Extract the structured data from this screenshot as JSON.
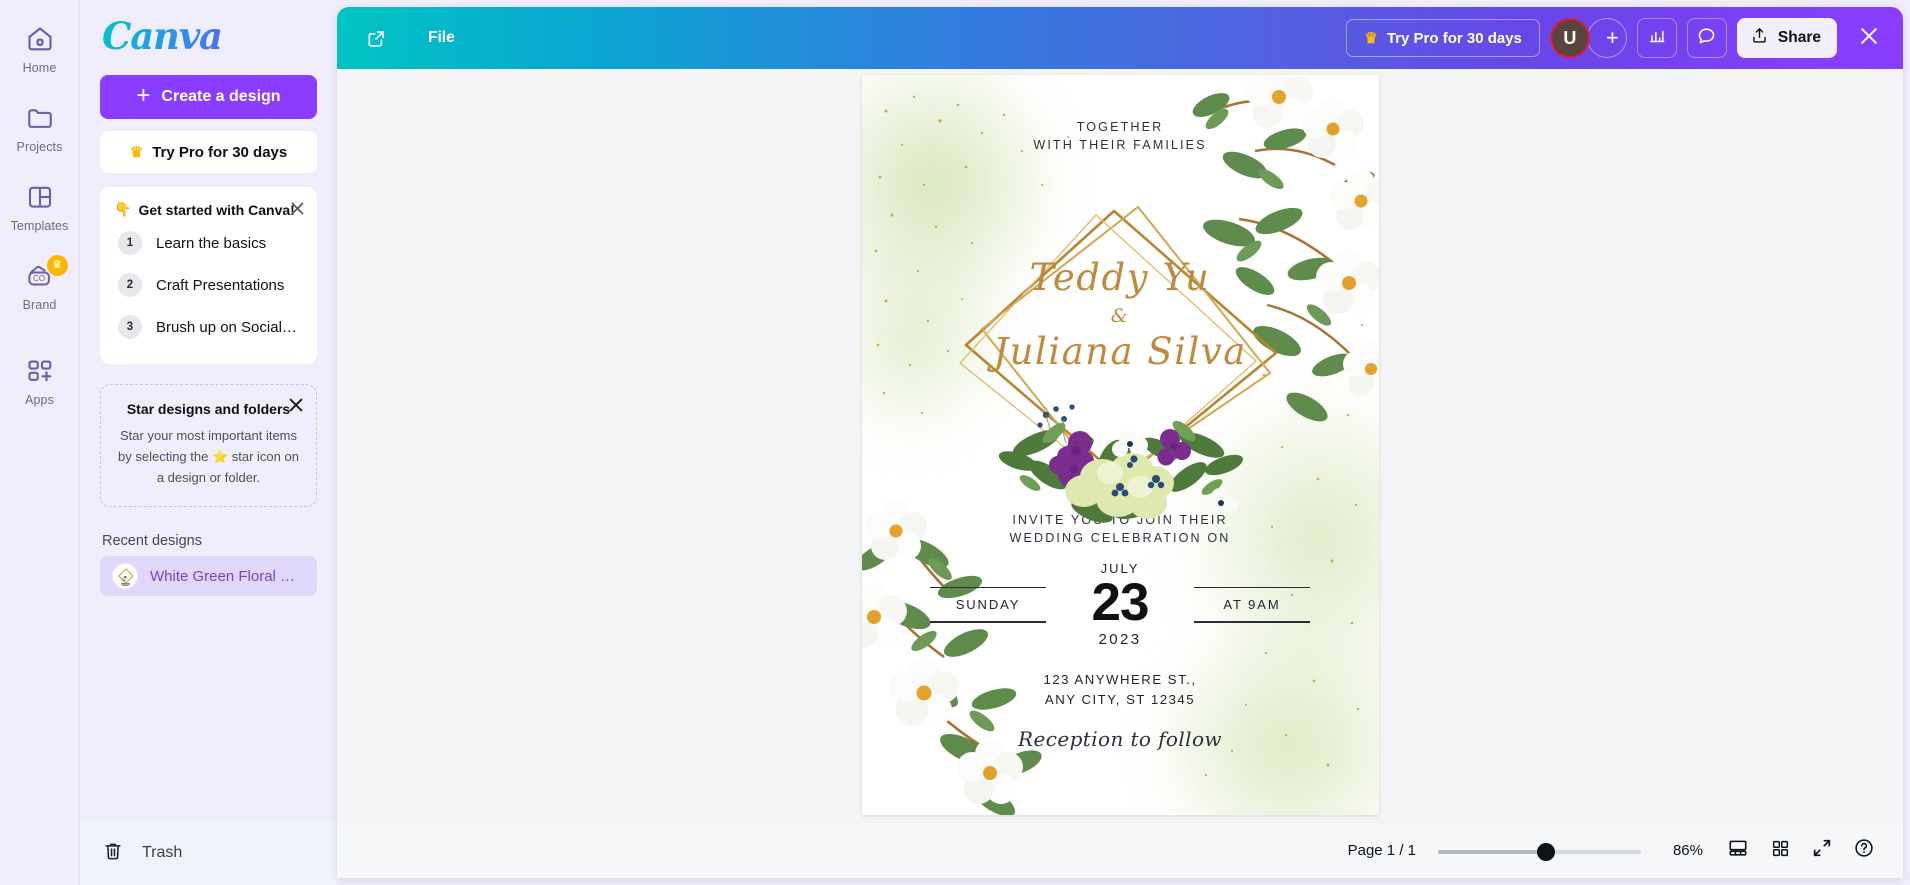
{
  "rail": {
    "items": [
      {
        "label": "Home",
        "icon": "home-icon",
        "pro": false
      },
      {
        "label": "Projects",
        "icon": "folder-icon",
        "pro": false
      },
      {
        "label": "Templates",
        "icon": "templates-icon",
        "pro": false
      },
      {
        "label": "Brand",
        "icon": "brand-icon",
        "pro": true
      },
      {
        "label": "Apps",
        "icon": "apps-icon",
        "pro": false
      }
    ]
  },
  "panel": {
    "logo": "Canva",
    "create_label": "Create a design",
    "try_pro_label": "Try Pro for 30 days",
    "get_started": {
      "title": "Get started with Canva!",
      "emoji": "👇",
      "close_icon": "close-icon",
      "items": [
        {
          "num": "1",
          "label": "Learn the basics"
        },
        {
          "num": "2",
          "label": "Craft Presentations"
        },
        {
          "num": "3",
          "label": "Brush up on Social Me..."
        }
      ]
    },
    "star_card": {
      "title": "Star designs and folders",
      "body": "Star your most important items by selecting the ⭐ star icon on a design or folder.",
      "close_icon": "close-icon"
    },
    "recent_heading": "Recent designs",
    "recent_item": "White Green Floral Wat...",
    "trash_label": "Trash"
  },
  "topbar": {
    "open_icon": "open-in-new-icon",
    "file_label": "File",
    "try_pro_label": "Try Pro for 30 days",
    "crown_icon": "crown-icon",
    "avatar_initial": "U",
    "add_people_icon": "plus-icon",
    "stats_icon": "bar-chart-icon",
    "comment_icon": "comment-icon",
    "share_label": "Share",
    "share_icon": "upload-icon",
    "close_icon": "close-icon"
  },
  "bottombar": {
    "page_label": "Page 1 / 1",
    "zoom_value": "86%",
    "zoom_percent": 53,
    "notes_icon": "notes-view-icon",
    "grid_icon": "grid-view-icon",
    "fullscreen_icon": "fullscreen-icon",
    "help_icon": "help-icon"
  },
  "invitation": {
    "together": "TOGETHER\nWITH THEIR FAMILIES",
    "name_one": "Teddy Yu",
    "ampersand": "&",
    "name_two": "Juliana Silva",
    "invite": "INVITE YOU TO JOIN THEIR\nWEDDING CELEBRATION ON",
    "day_name": "SUNDAY",
    "month": "JULY",
    "day_number": "23",
    "year": "2023",
    "time": "AT 9AM",
    "address": "123 ANYWHERE ST.,\nANY CITY, ST 12345",
    "reception": "Reception to follow"
  },
  "colors": {
    "brand_purple": "#8b3dff",
    "brand_teal": "#00c4cc",
    "panel_bg": "#f0eefb",
    "canvas_bg": "#f4f5f7",
    "gold": "#bd8a3e",
    "avatar_ring": "#e5173f",
    "crown_gold": "#ffb800"
  }
}
